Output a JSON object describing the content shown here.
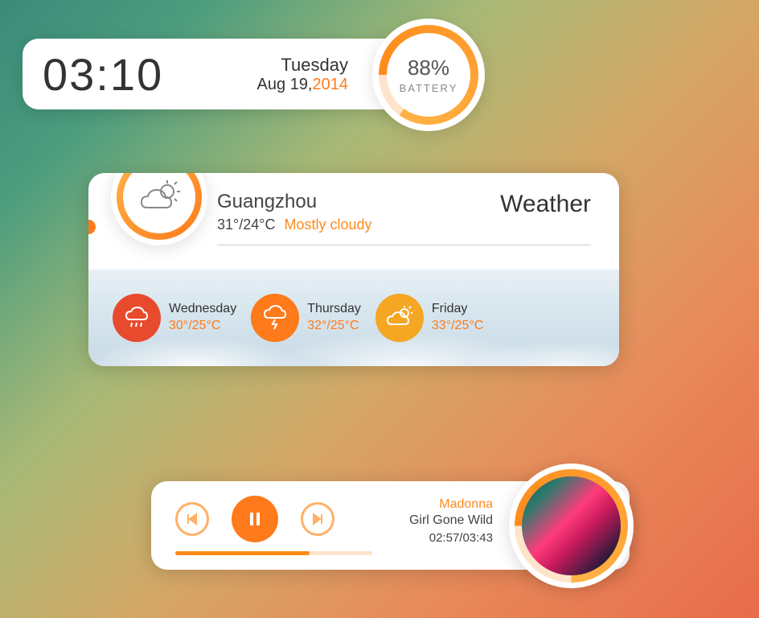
{
  "clock": {
    "time": "03:10",
    "day": "Tuesday",
    "date_prefix": "Aug 19,",
    "year": "2014"
  },
  "battery": {
    "percent": "88%",
    "label": "BATTERY"
  },
  "weather": {
    "title": "Weather",
    "city": "Guangzhou",
    "temps": "31°/24°C",
    "condition": "Mostly cloudy",
    "forecast": [
      {
        "day": "Wednesday",
        "temp": "30°/25°C",
        "icon": "rain",
        "color": "c-red"
      },
      {
        "day": "Thursday",
        "temp": "32°/25°C",
        "icon": "storm",
        "color": "c-orange"
      },
      {
        "day": "Friday",
        "temp": "33°/25°C",
        "icon": "partly",
        "color": "c-amber"
      }
    ]
  },
  "music": {
    "artist": "Madonna",
    "track": "Girl Gone Wild",
    "time": "02:57/03:43"
  }
}
